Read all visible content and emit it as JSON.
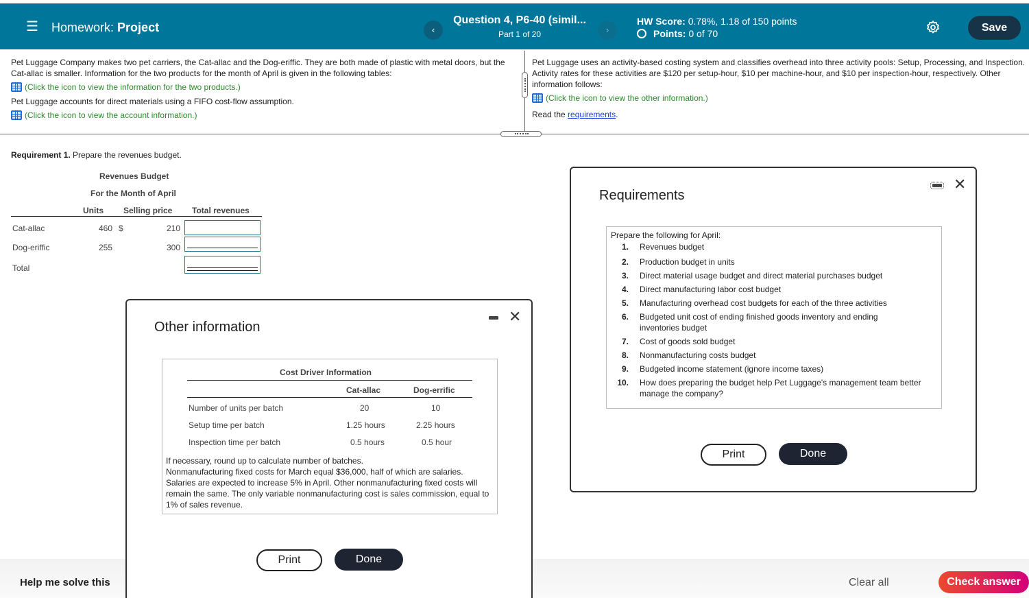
{
  "header": {
    "menu_icon": "hamburger-menu-icon",
    "homework_label": "Homework:",
    "homework_name": "Project",
    "question_title": "Question 4, P6-40 (simil...",
    "question_part": "Part 1 of 20",
    "prev_icon": "chevron-left-icon",
    "next_icon": "chevron-right-icon",
    "hw_score_label": "HW Score:",
    "hw_score_value": "0.78%, 1.18 of 150 points",
    "points_label": "Points:",
    "points_value": "0 of 70",
    "settings_icon": "gear-icon",
    "save_label": "Save"
  },
  "left_pane": {
    "paragraph1": "Pet Luggage Company makes two pet carriers, the Cat-allac and the Dog-eriffic. They are both made of plastic with metal doors, but the Cat-allac is smaller. Information for the two products for the month of April is given in the following tables:",
    "link1": "(Click the icon to view the information for the two products.)",
    "paragraph2": "Pet Luggage accounts for direct materials using a FIFO cost-flow assumption.",
    "link2": "(Click the icon to view the account information.)"
  },
  "right_pane": {
    "paragraph1": "Pet Luggage uses an activity-based costing system and classifies overhead into three activity pools: Setup, Processing, and Inspection. Activity rates for these activities are $120 per setup-hour, $10 per machine-hour, and $10 per inspection-hour, respectively. Other information follows:",
    "link1": "(Click the icon to view the other information.)",
    "read_prefix": "Read the ",
    "requirements_link": "requirements",
    "read_suffix": "."
  },
  "requirement1": {
    "label": "Requirement 1.",
    "text": " Prepare the revenues budget.",
    "budget_title": "Revenues Budget",
    "budget_subtitle": "For the Month of April",
    "columns": [
      "Units",
      "Selling price",
      "Total revenues"
    ],
    "rows": [
      {
        "name": "Cat-allac",
        "units": "460",
        "currency": "$",
        "price": "210",
        "total": ""
      },
      {
        "name": "Dog-eriffic",
        "units": "255",
        "currency": "",
        "price": "300",
        "total": ""
      },
      {
        "name": "Total",
        "units": "",
        "currency": "",
        "price": "",
        "total": ""
      }
    ]
  },
  "other_info_modal": {
    "title": "Other information",
    "table_title": "Cost Driver Information",
    "columns": [
      "Cat-allac",
      "Dog-errific"
    ],
    "rows": [
      {
        "label": "Number of units per batch",
        "cat": "20",
        "dog": "10"
      },
      {
        "label": "Setup time per batch",
        "cat": "1.25 hours",
        "dog": "2.25 hours"
      },
      {
        "label": "Inspection time per batch",
        "cat": "0.5 hours",
        "dog": "0.5 hour"
      }
    ],
    "notes": [
      "If necessary, round up to calculate number of batches.",
      "Nonmanufacturing fixed costs for March equal $36,000, half of which are salaries. Salaries are expected to increase 5% in April. Other nonmanufacturing fixed costs will remain the same. The only variable nonmanufacturing cost is sales commission, equal to 1% of sales revenue."
    ],
    "print_label": "Print",
    "done_label": "Done"
  },
  "requirements_modal": {
    "title": "Requirements",
    "intro": "Prepare the following for April:",
    "items": [
      {
        "n": "1.",
        "text": "Revenues budget"
      },
      {
        "n": "2.",
        "text": "Production budget in units"
      },
      {
        "n": "3.",
        "text": "Direct material usage budget and direct material purchases budget"
      },
      {
        "n": "4.",
        "text": "Direct manufacturing labor cost budget"
      },
      {
        "n": "5.",
        "text": "Manufacturing overhead cost budgets for each of the three activities"
      },
      {
        "n": "6.",
        "text": "Budgeted unit cost of ending finished goods inventory and ending inventories budget"
      },
      {
        "n": "7.",
        "text": "Cost of goods sold budget"
      },
      {
        "n": "8.",
        "text": "Nonmanufacturing costs budget"
      },
      {
        "n": "9.",
        "text": "Budgeted income statement (ignore income taxes)"
      },
      {
        "n": "10.",
        "text": "How does preparing the budget help Pet Luggage's management team better manage the company?"
      }
    ],
    "print_label": "Print",
    "done_label": "Done"
  },
  "footer": {
    "help_label": "Help me solve this",
    "clear_label": "Clear all",
    "check_label": "Check answer"
  },
  "colors": {
    "header_bg": "#00779a",
    "save_bg": "#163347",
    "link_green": "#2a8a2a",
    "check_gradient_start": "#ea4a2f",
    "check_gradient_end": "#d4007a"
  }
}
